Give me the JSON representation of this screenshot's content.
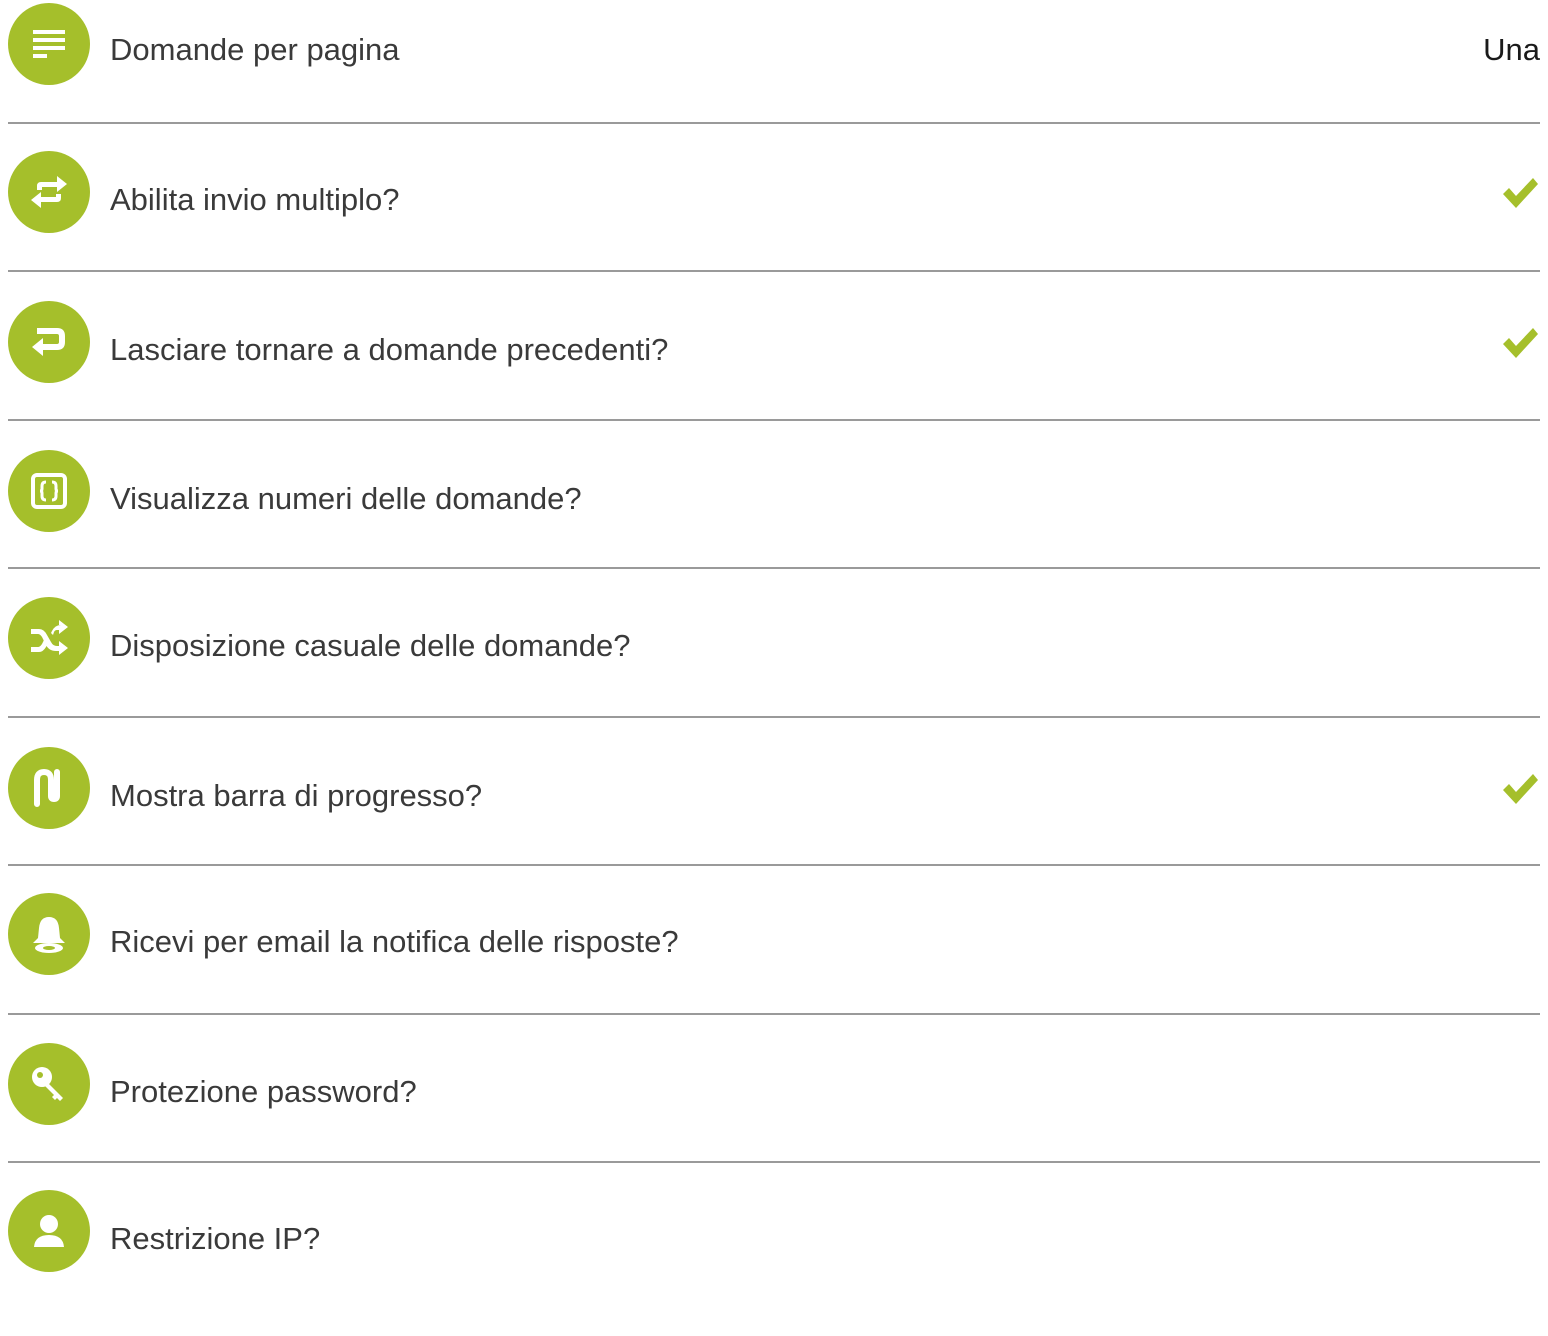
{
  "settings": [
    {
      "label": "Domande per pagina",
      "value": "Una",
      "checked": false,
      "icon": "text-lines-icon"
    },
    {
      "label": "Abilita invio multiplo?",
      "value": "",
      "checked": true,
      "icon": "repeat-icon"
    },
    {
      "label": "Lasciare tornare a domande precedenti?",
      "value": "",
      "checked": true,
      "icon": "return-arrow-icon"
    },
    {
      "label": "Visualizza numeri delle domande?",
      "value": "",
      "checked": false,
      "icon": "braces-box-icon"
    },
    {
      "label": "Disposizione casuale delle domande?",
      "value": "",
      "checked": false,
      "icon": "shuffle-icon"
    },
    {
      "label": "Mostra barra di progresso?",
      "value": "",
      "checked": true,
      "icon": "progress-path-icon"
    },
    {
      "label": "Ricevi per email la notifica delle risposte?",
      "value": "",
      "checked": false,
      "icon": "bell-icon"
    },
    {
      "label": "Protezione password?",
      "value": "",
      "checked": false,
      "icon": "key-icon"
    },
    {
      "label": "Restrizione IP?",
      "value": "",
      "checked": false,
      "icon": "user-icon"
    }
  ],
  "colors": {
    "accent": "#a5bf2b",
    "divider": "#9a9a9a",
    "text": "#3a3a3a"
  }
}
